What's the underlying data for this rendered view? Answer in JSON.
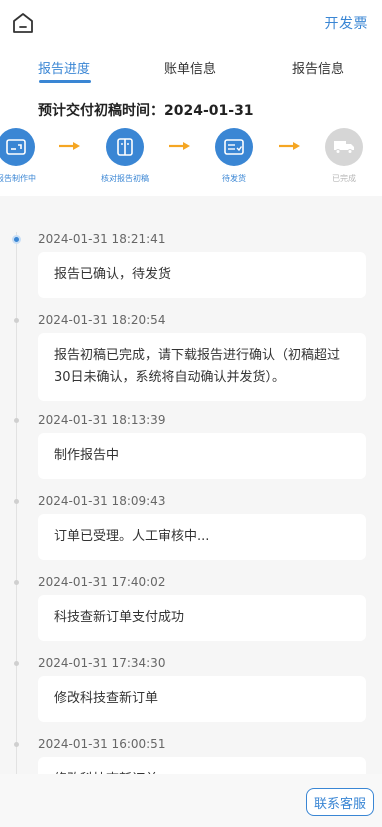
{
  "header": {
    "invoice_label": "开发票"
  },
  "tabs": [
    {
      "label": "报告进度"
    },
    {
      "label": "账单信息"
    },
    {
      "label": "报告信息"
    }
  ],
  "delivery": {
    "label": "预计交付初稿时间：",
    "value": "2024-01-31"
  },
  "steps": [
    {
      "label": "报告制作中",
      "icon": "report-draft-icon",
      "state": "done"
    },
    {
      "label": "核对报告初稿",
      "icon": "document-check-icon",
      "state": "done"
    },
    {
      "label": "待发货",
      "icon": "checklist-icon",
      "state": "current"
    },
    {
      "label": "已完成",
      "icon": "truck-icon",
      "state": "pending"
    }
  ],
  "timeline": [
    {
      "time": "2024-01-31 18:21:41",
      "text": "报告已确认，待发货",
      "active": true
    },
    {
      "time": "2024-01-31 18:20:54",
      "text": "报告初稿已完成，请下载报告进行确认（初稿超过30日未确认，系统将自动确认并发货）。",
      "active": false
    },
    {
      "time": "2024-01-31 18:13:39",
      "text": "制作报告中",
      "active": false
    },
    {
      "time": "2024-01-31 18:09:43",
      "text": "订单已受理。人工审核中...",
      "active": false
    },
    {
      "time": "2024-01-31 17:40:02",
      "text": "科技查新订单支付成功",
      "active": false
    },
    {
      "time": "2024-01-31 17:34:30",
      "text": "修改科技查新订单",
      "active": false
    },
    {
      "time": "2024-01-31 16:00:51",
      "text": "修改科技查新订单",
      "active": false
    }
  ],
  "footer": {
    "service_label": "联系客服"
  },
  "colors": {
    "accent": "#3a86d4",
    "arrow": "#f5a623",
    "inactive": "#d6d6d6"
  }
}
